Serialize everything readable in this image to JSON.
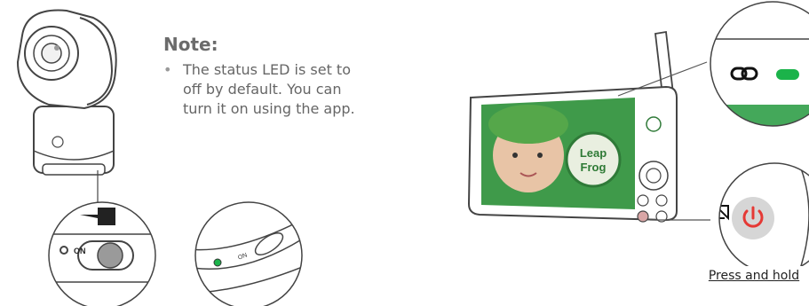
{
  "note": {
    "title": "Note:",
    "bullet": "•",
    "text": "The status LED is set to off by default. You can turn it on using the app."
  },
  "switch_zoom": {
    "on_label": "ON"
  },
  "led_zoom": {
    "on_label": "ON"
  },
  "monitor": {
    "brand_text": "LeapFrog",
    "press_and_hold": "Press and hold"
  },
  "colors": {
    "led_green": "#1bb34a",
    "power_red": "#e53935",
    "screen_green": "#3f9a4a",
    "line_gray": "#555555"
  },
  "icons": [
    "link-icon",
    "power-icon",
    "screen-cast-icon",
    "arrow-left-icon"
  ]
}
